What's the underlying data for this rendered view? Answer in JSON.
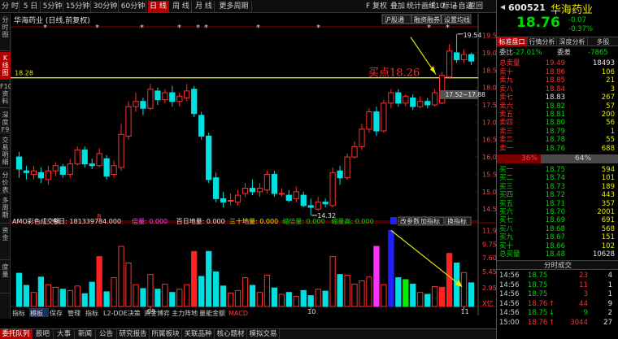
{
  "toolbar": {
    "items": [
      "分 时",
      "5 日",
      "5分钟",
      "15分钟",
      "30分钟",
      "60分钟",
      "日 线",
      "周 线",
      "月 线",
      "更多周期"
    ],
    "active": "日 线",
    "right": [
      "F",
      "复权",
      "叠加",
      "统计",
      "画线",
      "F10",
      "标记",
      "+自选",
      "返回"
    ]
  },
  "left_tabs": [
    "分时图",
    "K线图",
    "F10资料",
    "深度F9",
    "交易明细",
    "分价表",
    "多周期",
    "资金",
    "度量"
  ],
  "chart": {
    "stock_title": "华海药业 (日线,前复权)",
    "buttons": [
      "沪股通",
      "融资融券",
      "设置均线"
    ],
    "price_axis": [
      "19.50",
      "19.00",
      "18.50",
      "18.00",
      "17.50",
      "17.00",
      "16.50",
      "16.00",
      "15.50",
      "15.00",
      "14.50"
    ],
    "hline_label": "18.28",
    "annotations": {
      "high": "19.54",
      "low": "14.32",
      "range": "17.52~17.88",
      "buy": "买点18.26"
    },
    "vol_legend": {
      "name": "AMO彩色成交额",
      "today": "今日: 181339784.000",
      "i1": "倍量: 0.000",
      "i2": "百日地量: 0.000",
      "i3": "三十地量: 0.000",
      "i4": "缩倍量: 0.000",
      "i5": "缩量高: 0.000",
      "btn1": "改参数",
      "btn2": "加指标",
      "btn3": "换指标"
    },
    "vol_axis": [
      "11.90",
      "9.75",
      "7.60",
      "5.45",
      "2.95"
    ],
    "vol_unit": "X亿",
    "date_labels": [
      "09",
      "10",
      "11"
    ],
    "marker_b": "B",
    "subtabs": [
      "指标",
      "模板",
      "保存",
      "管理",
      "指标",
      "L2-DDE决策",
      "资金博弈",
      "主力阵地",
      "量能金额",
      "MACD"
    ]
  },
  "bottom_tabs": [
    "委托队列",
    "股吧",
    "大事",
    "新闻",
    "公告",
    "研究报告",
    "所属板块",
    "关联品种",
    "核心题材",
    "模拟交易"
  ],
  "right_panel": {
    "code": "600521",
    "name": "华海药业",
    "price": "18.76",
    "chg": "-0.07",
    "pct": "-0.37%",
    "tabs": [
      "标准盘口",
      "行情分析",
      "深度分析",
      "多股"
    ],
    "webi_label": "委比",
    "webi": "-27.01%",
    "weicha_label": "委差",
    "weicha": "-7865",
    "sell_total": {
      "label": "总卖量",
      "price": "19.49",
      "vol": "18493"
    },
    "asks": [
      [
        "卖十",
        "18.86",
        "106"
      ],
      [
        "卖九",
        "18.85",
        "21"
      ],
      [
        "卖八",
        "18.84",
        "3"
      ],
      [
        "卖七",
        "18.83",
        "267"
      ],
      [
        "卖六",
        "18.82",
        "57"
      ],
      [
        "卖五",
        "18.81",
        "200"
      ],
      [
        "卖四",
        "18.80",
        "56"
      ],
      [
        "卖三",
        "18.79",
        "1"
      ],
      [
        "卖二",
        "18.78",
        "55"
      ],
      [
        "卖一",
        "18.76",
        "688"
      ]
    ],
    "bar_left": "36%",
    "bar_right": "64%",
    "bids": [
      [
        "买一",
        "18.75",
        "594"
      ],
      [
        "买二",
        "18.74",
        "101"
      ],
      [
        "买三",
        "18.73",
        "189"
      ],
      [
        "买四",
        "18.72",
        "443"
      ],
      [
        "买五",
        "18.71",
        "357"
      ],
      [
        "买六",
        "18.70",
        "2001"
      ],
      [
        "买七",
        "18.69",
        "691"
      ],
      [
        "买八",
        "18.68",
        "568"
      ],
      [
        "买九",
        "18.67",
        "151"
      ],
      [
        "买十",
        "18.66",
        "102"
      ]
    ],
    "buy_total": {
      "label": "总买量",
      "price": "18.48",
      "vol": "10628"
    },
    "ticks_title": "分时成交",
    "ticks": [
      [
        "14:56",
        "18.75",
        "",
        "23",
        "4"
      ],
      [
        "14:56",
        "18.75",
        "",
        "11",
        "1"
      ],
      [
        "14:56",
        "18.75",
        "",
        "3",
        "1"
      ],
      [
        "14:56",
        "18.76",
        "↑",
        "44",
        "9"
      ],
      [
        "14:56",
        "18.75",
        "↓",
        "9",
        "2"
      ],
      [
        "15:00",
        "18.76",
        "↑",
        "3044",
        "27"
      ]
    ]
  },
  "chart_data": {
    "type": "candlestick",
    "price_ylim": [
      14.2,
      19.7
    ],
    "hline": 18.28,
    "candles": [
      [
        16.0,
        15.65,
        16.15,
        15.4
      ],
      [
        15.6,
        15.55,
        15.75,
        15.35
      ],
      [
        15.5,
        15.6,
        15.75,
        15.35
      ],
      [
        15.55,
        15.4,
        15.7,
        15.25
      ],
      [
        15.35,
        15.6,
        15.75,
        15.2
      ],
      [
        15.6,
        15.75,
        15.85,
        15.45
      ],
      [
        15.72,
        15.5,
        15.8,
        15.4
      ],
      [
        15.5,
        15.8,
        15.95,
        15.4
      ],
      [
        15.8,
        16.2,
        16.3,
        15.75
      ],
      [
        16.2,
        15.8,
        16.3,
        15.7
      ],
      [
        15.8,
        15.75,
        15.95,
        15.65
      ],
      [
        15.75,
        16.1,
        16.25,
        15.7
      ],
      [
        15.95,
        15.45,
        16.05,
        15.35
      ],
      [
        15.5,
        15.75,
        15.9,
        15.4
      ],
      [
        15.7,
        16.65,
        16.95,
        15.6
      ],
      [
        16.6,
        17.45,
        17.6,
        16.5
      ],
      [
        17.45,
        17.6,
        17.85,
        17.3
      ],
      [
        17.6,
        17.4,
        17.7,
        17.2
      ],
      [
        17.4,
        17.95,
        18.1,
        17.35
      ],
      [
        17.9,
        17.65,
        18.0,
        17.5
      ],
      [
        17.65,
        17.85,
        17.95,
        17.55
      ],
      [
        17.85,
        17.6,
        18.05,
        17.45
      ],
      [
        17.6,
        17.75,
        17.85,
        17.45
      ],
      [
        17.7,
        17.9,
        18.1,
        17.6
      ],
      [
        17.95,
        17.25,
        18.05,
        17.15
      ],
      [
        17.2,
        16.6,
        17.3,
        16.5
      ],
      [
        16.6,
        15.35,
        16.7,
        15.25
      ],
      [
        15.4,
        14.8,
        15.55,
        14.7
      ],
      [
        14.8,
        14.7,
        15.0,
        14.55
      ],
      [
        14.75,
        14.75,
        14.95,
        14.6
      ],
      [
        14.7,
        14.9,
        15.05,
        14.6
      ],
      [
        14.95,
        15.1,
        15.25,
        14.85
      ],
      [
        15.1,
        15.0,
        15.35,
        14.9
      ],
      [
        15.0,
        15.1,
        15.25,
        14.85
      ],
      [
        15.05,
        15.5,
        15.6,
        14.95
      ],
      [
        15.5,
        14.95,
        15.6,
        14.85
      ],
      [
        14.95,
        14.95,
        15.1,
        14.85
      ],
      [
        14.9,
        14.75,
        15.05,
        14.7
      ],
      [
        14.8,
        15.0,
        15.15,
        14.7
      ],
      [
        14.9,
        14.6,
        15.0,
        14.55
      ],
      [
        14.6,
        14.55,
        14.8,
        14.32
      ],
      [
        14.5,
        14.7,
        14.85,
        14.45
      ],
      [
        14.7,
        14.65,
        14.8,
        14.55
      ],
      [
        14.6,
        15.55,
        15.7,
        14.55
      ],
      [
        15.6,
        15.4,
        15.75,
        15.2
      ],
      [
        15.4,
        16.0,
        16.1,
        15.35
      ],
      [
        16.0,
        16.3,
        16.45,
        15.95
      ],
      [
        16.3,
        16.8,
        16.95,
        16.2
      ],
      [
        16.8,
        17.3,
        17.4,
        16.7
      ],
      [
        17.3,
        16.75,
        17.45,
        16.6
      ],
      [
        16.75,
        17.55,
        17.65,
        16.7
      ],
      [
        17.55,
        17.85,
        17.95,
        17.4
      ],
      [
        17.85,
        17.55,
        17.95,
        17.45
      ],
      [
        17.55,
        17.75,
        17.8,
        17.45
      ],
      [
        17.7,
        17.45,
        17.8,
        17.35
      ],
      [
        17.45,
        17.6,
        17.75,
        17.4
      ],
      [
        17.6,
        17.5,
        17.7,
        17.4
      ],
      [
        17.5,
        17.85,
        17.95,
        17.45
      ],
      [
        17.55,
        18.35,
        18.45,
        17.52
      ],
      [
        18.3,
        19.05,
        19.25,
        18.25
      ],
      [
        19.0,
        18.8,
        19.54,
        18.7
      ],
      [
        18.8,
        18.95,
        19.1,
        18.7
      ],
      [
        18.95,
        18.76,
        19.0,
        18.65
      ]
    ],
    "vol_ylim": [
      0,
      12.2
    ],
    "volumes": [
      5.2,
      3.3,
      2.2,
      4.6,
      3.4,
      3.0,
      2.7,
      2.5,
      3.2,
      2.0,
      3.8,
      7.8,
      2.3,
      4.5,
      9.4,
      6.8,
      3.4,
      2.8,
      5.0,
      2.7,
      3.5,
      2.2,
      2.7,
      3.4,
      8.6,
      4.7,
      8.6,
      5.4,
      3.2,
      2.1,
      2.5,
      4.5,
      3.3,
      2.2,
      4.9,
      2.9,
      1.9,
      2.2,
      1.6,
      2.5,
      1.7,
      2.7,
      2.4,
      7.8,
      5.0,
      4.9,
      3.5,
      4.0,
      4.6,
      9.4,
      3.4,
      11.9,
      4.5,
      4.2,
      3.5,
      2.2,
      1.9,
      3.1,
      3.0,
      8.3,
      6.8,
      5.3,
      3.7
    ],
    "vol_colors": {
      "11": "#ff2020",
      "24": "#ff2020",
      "49": "#ff30ff",
      "51": "#2020ff",
      "53": "#00ee00",
      "58": "#ff2020",
      "59": "#ff2020"
    }
  }
}
